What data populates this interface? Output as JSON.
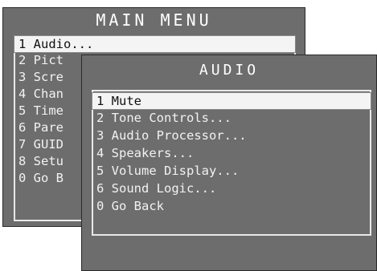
{
  "main_menu": {
    "title": "MAIN MENU",
    "items": [
      {
        "label": "1 Audio..."
      },
      {
        "label": "2 Pict"
      },
      {
        "label": "3 Scre"
      },
      {
        "label": "4 Chan"
      },
      {
        "label": "5 Time"
      },
      {
        "label": "6 Pare"
      },
      {
        "label": "7 GUID"
      },
      {
        "label": "8 Setu"
      },
      {
        "label": "0 Go B"
      }
    ],
    "selected_index": 0
  },
  "audio_menu": {
    "title": "AUDIO",
    "items": [
      {
        "label": "1 Mute"
      },
      {
        "label": "2 Tone Controls..."
      },
      {
        "label": "3 Audio Processor..."
      },
      {
        "label": "4 Speakers..."
      },
      {
        "label": "5 Volume Display..."
      },
      {
        "label": "6 Sound Logic..."
      },
      {
        "label": "0 Go Back"
      }
    ],
    "selected_index": 0
  },
  "colors": {
    "window_background": "#6d6d6d",
    "highlight_background": "#f4f4f4",
    "text": "#f2f2f2",
    "highlight_text": "#111111"
  }
}
